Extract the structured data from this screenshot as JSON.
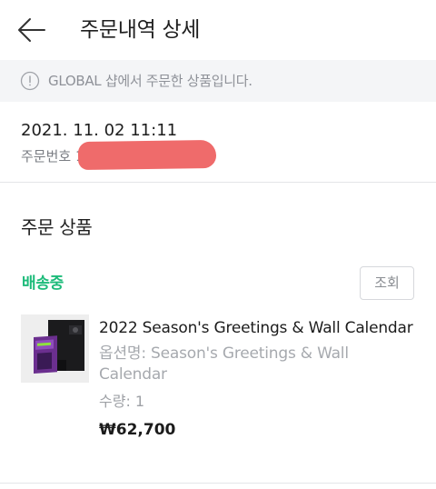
{
  "header": {
    "title": "주문내역 상세",
    "back_icon": "arrow-left-icon"
  },
  "notice": {
    "icon": "info-circle-icon",
    "text": "GLOBAL 샵에서 주문한 상품입니다."
  },
  "order": {
    "date": "2021. 11. 02 11:11",
    "number_label": "주문번호 1"
  },
  "section": {
    "title": "주문 상품"
  },
  "item": {
    "status": "배송중",
    "status_color": "#1dbb7a",
    "lookup_label": "조회",
    "name": "2022 Season's Greetings & Wall Calendar",
    "option": "옵션명: Season's Greetings & Wall Calendar",
    "quantity": "수량: 1",
    "price": "₩62,700"
  }
}
